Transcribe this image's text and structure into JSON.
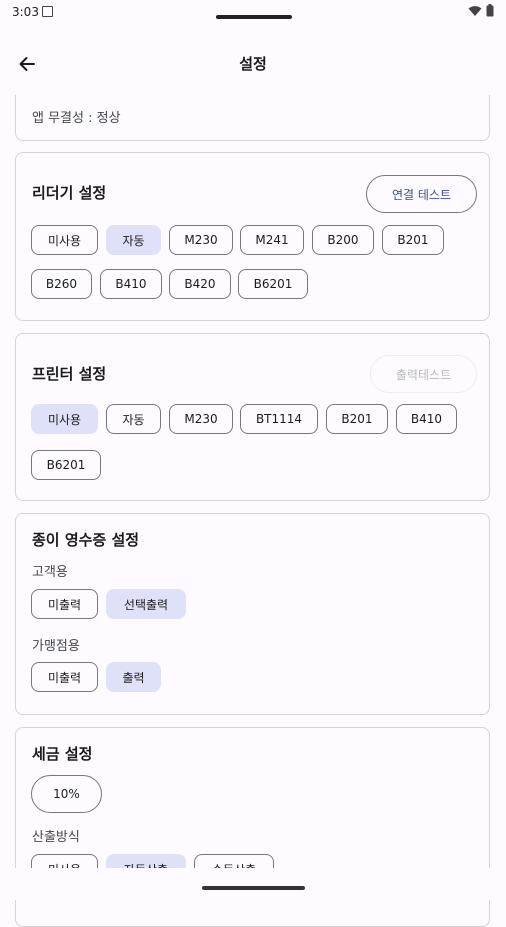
{
  "status_bar": {
    "time": "3:03"
  },
  "app_bar": {
    "title": "설정"
  },
  "integrity": {
    "text": "앱 무결성 : 정상"
  },
  "reader": {
    "title": "리더기 설정",
    "test_button": "연결 테스트",
    "options": [
      "미사용",
      "자동",
      "M230",
      "M241",
      "B200",
      "B201",
      "B260",
      "B410",
      "B420",
      "B6201"
    ],
    "selected": "자동"
  },
  "printer": {
    "title": "프린터 설정",
    "test_button": "출력테스트",
    "options": [
      "미사용",
      "자동",
      "M230",
      "BT1114",
      "B201",
      "B410",
      "B6201"
    ],
    "selected": "미사용"
  },
  "receipt": {
    "title": "종이 영수증 설정",
    "customer": {
      "label": "고객용",
      "options": [
        "미출력",
        "선택출력"
      ],
      "selected": "선택출력"
    },
    "merchant": {
      "label": "가맹점용",
      "options": [
        "미출력",
        "출력"
      ],
      "selected": "출력"
    }
  },
  "tax": {
    "title": "세금 설정",
    "rate_button": "10%",
    "method_label": "산출방식",
    "options": [
      "미사용",
      "자동산출",
      "수동산출"
    ],
    "selected": "자동산출"
  }
}
